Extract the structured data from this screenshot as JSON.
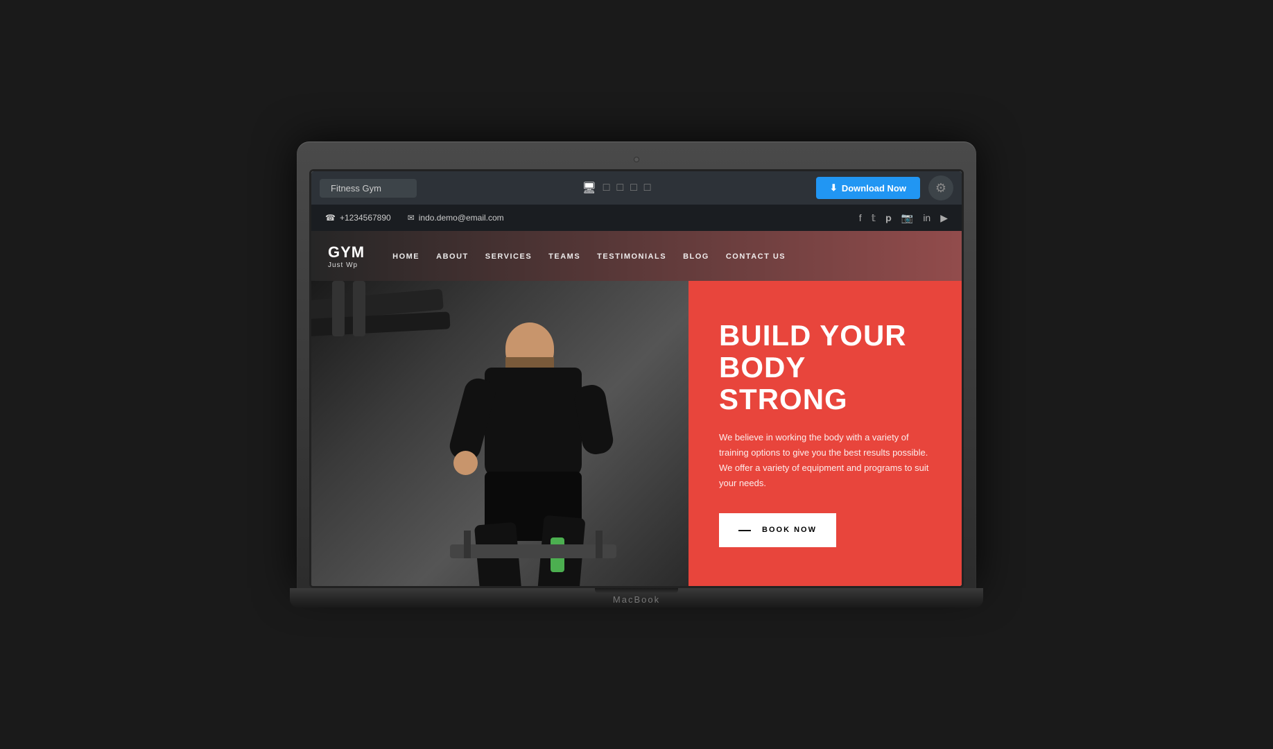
{
  "laptop": {
    "brand": "MacBook"
  },
  "toolbar": {
    "title": "Fitness Gym",
    "download_label": "Download Now",
    "download_icon": "⬇",
    "gear_icon": "⚙",
    "devices": [
      {
        "name": "desktop",
        "icon": "🖥",
        "active": true
      },
      {
        "name": "laptop",
        "icon": "💻",
        "active": false
      },
      {
        "name": "tablet",
        "icon": "📱",
        "active": false
      },
      {
        "name": "tablet-small",
        "icon": "📱",
        "active": false
      },
      {
        "name": "mobile",
        "icon": "📱",
        "active": false
      }
    ]
  },
  "contact_bar": {
    "phone": "+1234567890",
    "email": "indo.demo@email.com",
    "phone_icon": "☎",
    "email_icon": "✉",
    "socials": [
      "f",
      "t",
      "p",
      "ig",
      "in",
      "yt"
    ]
  },
  "site": {
    "logo_main": "GYM",
    "logo_sub": "Just Wp",
    "nav_items": [
      {
        "label": "HOME"
      },
      {
        "label": "ABOUT"
      },
      {
        "label": "SERVICES"
      },
      {
        "label": "TEAMS"
      },
      {
        "label": "TESTIMONIALS"
      },
      {
        "label": "BLOG"
      },
      {
        "label": "CONTACT US"
      }
    ]
  },
  "hero": {
    "headline_line1": "BUILD YOUR BODY",
    "headline_line2": "STRONG",
    "description": "We believe in working the body with a variety of training options to give you the best results possible. We offer a variety of equipment and programs to suit your needs.",
    "cta_label": "BOOK NOW",
    "cta_arrow": "—"
  },
  "colors": {
    "hero_bg": "#e8453c",
    "toolbar_bg": "#2d3238",
    "contact_bar_bg": "#1a1d21",
    "download_btn_bg": "#2196F3",
    "site_header_bg": "rgba(0,0,0,0.85)"
  }
}
